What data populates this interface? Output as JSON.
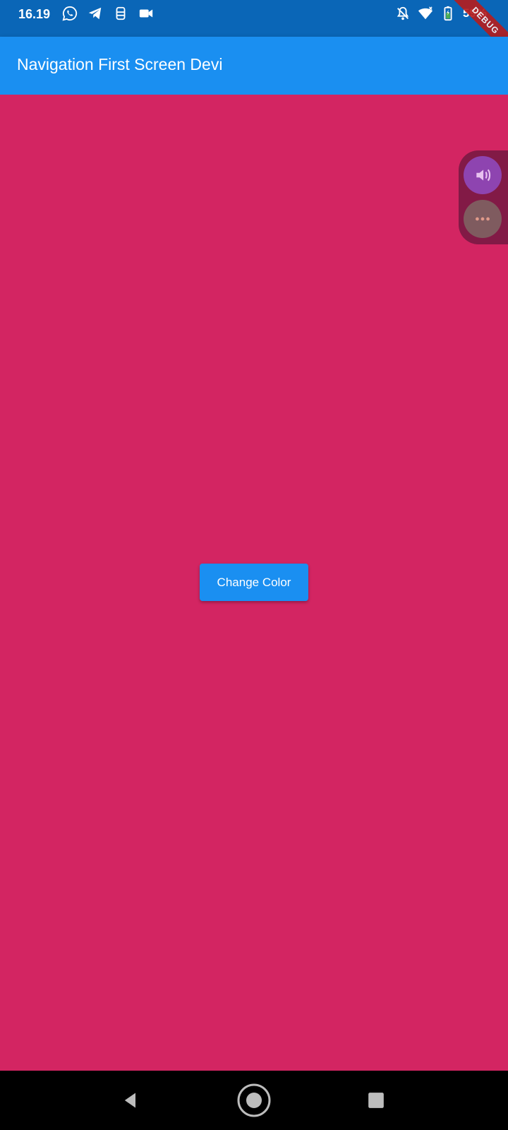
{
  "status_bar": {
    "time": "16.19",
    "battery": "59%",
    "left_icons": [
      "whatsapp-icon",
      "telegram-icon",
      "sim-icon",
      "video-camera-icon"
    ],
    "right_icons": [
      "notifications-off-icon",
      "wifi-icon",
      "battery-icon"
    ]
  },
  "debug_banner": "DEBUG",
  "app_bar": {
    "title": "Navigation First Screen Devi"
  },
  "main": {
    "button_label": "Change Color",
    "background_color": "#d32562",
    "button_color": "#1a8ff1"
  },
  "floating_panel": {
    "buttons": [
      "sound-icon",
      "more-icon"
    ]
  },
  "nav_bar": {
    "buttons": [
      "back-icon",
      "home-icon",
      "recents-icon"
    ]
  },
  "colors": {
    "status_bar": "#0a66b7",
    "app_bar": "#1a8ff1",
    "content": "#d32562"
  }
}
